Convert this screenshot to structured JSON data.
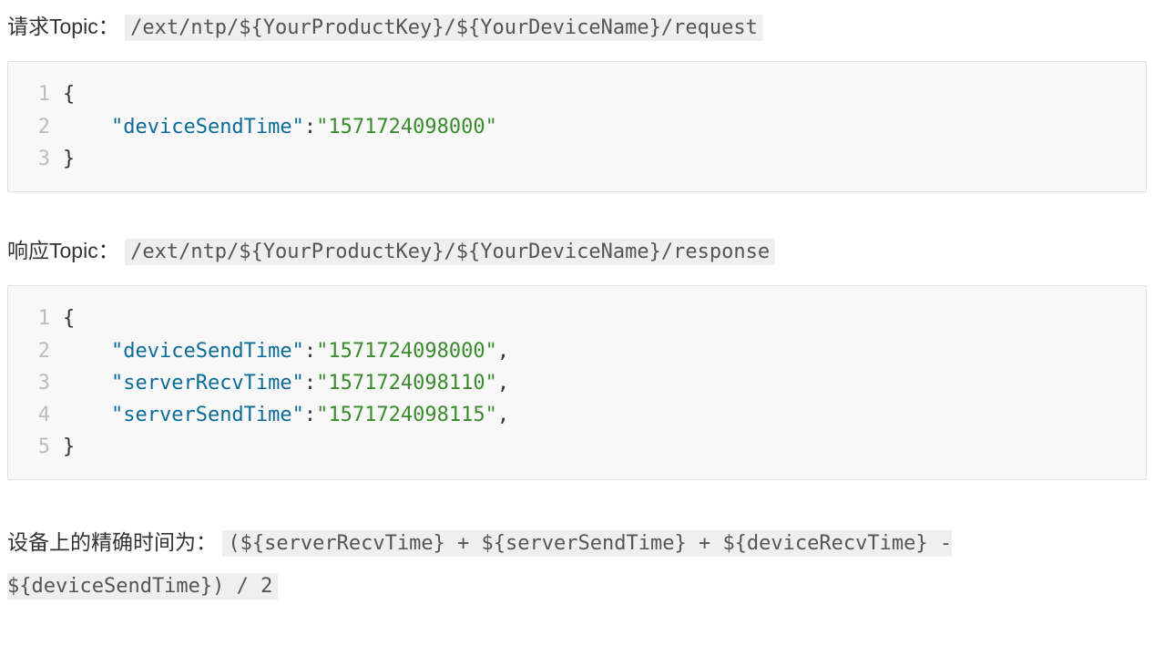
{
  "request": {
    "label": "请求Topic：",
    "topic": "/ext/ntp/${YourProductKey}/${YourDeviceName}/request",
    "code": [
      {
        "ln": "1",
        "tokens": [
          {
            "t": "punc",
            "v": "{"
          }
        ]
      },
      {
        "ln": "2",
        "tokens": [
          {
            "t": "indent",
            "v": "    "
          },
          {
            "t": "strkey",
            "v": "\"deviceSendTime\""
          },
          {
            "t": "punc",
            "v": ":"
          },
          {
            "t": "strval",
            "v": "\"1571724098000\""
          }
        ]
      },
      {
        "ln": "3",
        "tokens": [
          {
            "t": "punc",
            "v": "}"
          }
        ]
      }
    ]
  },
  "response": {
    "label": "响应Topic：",
    "topic": "/ext/ntp/${YourProductKey}/${YourDeviceName}/response",
    "code": [
      {
        "ln": "1",
        "tokens": [
          {
            "t": "punc",
            "v": "{"
          }
        ]
      },
      {
        "ln": "2",
        "tokens": [
          {
            "t": "indent",
            "v": "    "
          },
          {
            "t": "strkey",
            "v": "\"deviceSendTime\""
          },
          {
            "t": "punc",
            "v": ":"
          },
          {
            "t": "strval",
            "v": "\"1571724098000\""
          },
          {
            "t": "punc",
            "v": ","
          }
        ]
      },
      {
        "ln": "3",
        "tokens": [
          {
            "t": "indent",
            "v": "    "
          },
          {
            "t": "strkey",
            "v": "\"serverRecvTime\""
          },
          {
            "t": "punc",
            "v": ":"
          },
          {
            "t": "strval",
            "v": "\"1571724098110\""
          },
          {
            "t": "punc",
            "v": ","
          }
        ]
      },
      {
        "ln": "4",
        "tokens": [
          {
            "t": "indent",
            "v": "    "
          },
          {
            "t": "strkey",
            "v": "\"serverSendTime\""
          },
          {
            "t": "punc",
            "v": ":"
          },
          {
            "t": "strval",
            "v": "\"1571724098115\""
          },
          {
            "t": "punc",
            "v": ","
          }
        ]
      },
      {
        "ln": "5",
        "tokens": [
          {
            "t": "punc",
            "v": "}"
          }
        ]
      }
    ]
  },
  "formula": {
    "label": "设备上的精确时间为：",
    "expr": "(${serverRecvTime} + ${serverSendTime} + ${deviceRecvTime} - ${deviceSendTime}) / 2"
  }
}
